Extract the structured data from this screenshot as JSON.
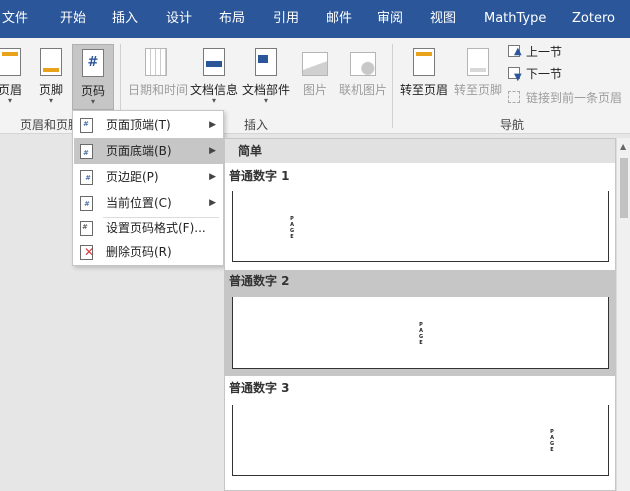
{
  "ribbon": {
    "tabs": [
      {
        "label": "文件"
      },
      {
        "label": "开始"
      },
      {
        "label": "插入"
      },
      {
        "label": "设计"
      },
      {
        "label": "布局"
      },
      {
        "label": "引用"
      },
      {
        "label": "邮件"
      },
      {
        "label": "审阅"
      },
      {
        "label": "视图"
      },
      {
        "label": "MathType"
      },
      {
        "label": "Zotero"
      }
    ],
    "header_footer_group": {
      "header_label": "页眉",
      "footer_label": "页脚",
      "page_number_label": "页码",
      "group_label": "页眉和页脚",
      "dropdown_glyph": "▾"
    },
    "insert_group": {
      "datetime_label": "日期和时间",
      "docinfo_label": "文档信息",
      "docparts_label": "文档部件",
      "picture_label": "图片",
      "online_picture_label": "联机图片",
      "group_label": "插入"
    },
    "nav_group": {
      "goto_header_label": "转至页眉",
      "goto_footer_label": "转至页脚",
      "prev_section_label": "上一节",
      "next_section_label": "下一节",
      "link_previous_label": "链接到前一条页眉",
      "group_label": "导航"
    }
  },
  "page_number_menu": {
    "items": [
      {
        "label": "页面顶端(T)",
        "has_submenu": true
      },
      {
        "label": "页面底端(B)",
        "has_submenu": true
      },
      {
        "label": "页边距(P)",
        "has_submenu": true
      },
      {
        "label": "当前位置(C)",
        "has_submenu": true
      },
      {
        "label": "设置页码格式(F)...",
        "has_submenu": false
      },
      {
        "label": "删除页码(R)",
        "has_submenu": false
      }
    ],
    "submenu_arrow": "▶"
  },
  "gallery": {
    "section_header": "简单",
    "items": [
      {
        "title": "普通数字 1",
        "field_text": "PAGE"
      },
      {
        "title": "普通数字 2",
        "field_text": "PAGE"
      },
      {
        "title": "普通数字 3",
        "field_text": "PAGE"
      }
    ]
  }
}
